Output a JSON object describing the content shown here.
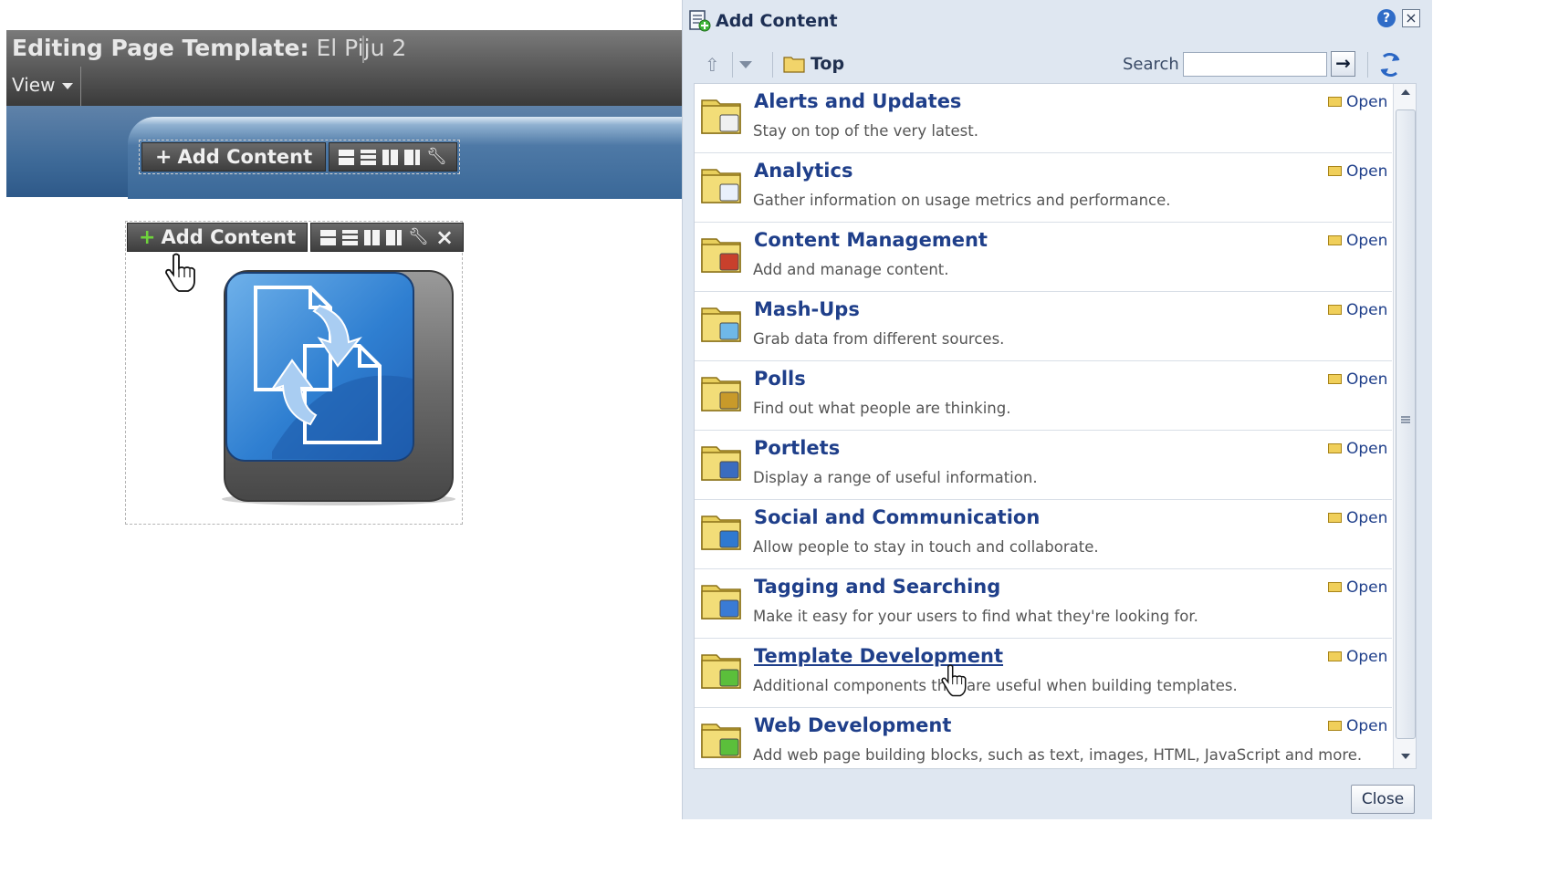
{
  "editor": {
    "title_prefix": "Editing Page Template:",
    "title_name": "El Piju 2",
    "view_menu": "View",
    "add_content_label": "Add Content"
  },
  "dialog": {
    "title": "Add Content",
    "help_icon": "?",
    "close_icon": "×",
    "breadcrumb": "Top",
    "search_label": "Search",
    "search_value": "",
    "search_go": "→",
    "close_button": "Close",
    "items": [
      {
        "title": "Alerts and Updates",
        "desc": "Stay on top of the very latest.",
        "open": "Open",
        "icon": "alerts-folder-icon"
      },
      {
        "title": "Analytics",
        "desc": "Gather information on usage metrics and performance.",
        "open": "Open",
        "icon": "analytics-folder-icon"
      },
      {
        "title": "Content Management",
        "desc": "Add and manage content.",
        "open": "Open",
        "icon": "content-folder-icon"
      },
      {
        "title": "Mash-Ups",
        "desc": "Grab data from different sources.",
        "open": "Open",
        "icon": "mashups-folder-icon"
      },
      {
        "title": "Polls",
        "desc": "Find out what people are thinking.",
        "open": "Open",
        "icon": "polls-folder-icon"
      },
      {
        "title": "Portlets",
        "desc": "Display a range of useful information.",
        "open": "Open",
        "icon": "portlets-folder-icon"
      },
      {
        "title": "Social and Communication",
        "desc": "Allow people to stay in touch and collaborate.",
        "open": "Open",
        "icon": "social-folder-icon"
      },
      {
        "title": "Tagging and Searching",
        "desc": "Make it easy for your users to find what they're looking for.",
        "open": "Open",
        "icon": "tagging-folder-icon"
      },
      {
        "title": "Template Development",
        "desc": "Additional components that are useful when building templates.",
        "open": "Open",
        "icon": "template-folder-icon"
      },
      {
        "title": "Web Development",
        "desc": "Add web page building blocks, such as text, images, HTML, JavaScript and more.",
        "open": "Open",
        "icon": "web-folder-icon"
      }
    ]
  },
  "colors": {
    "link": "#1f3f8a",
    "header_band": "#3e6a98",
    "dialog_bg": "#dfe7f1"
  }
}
